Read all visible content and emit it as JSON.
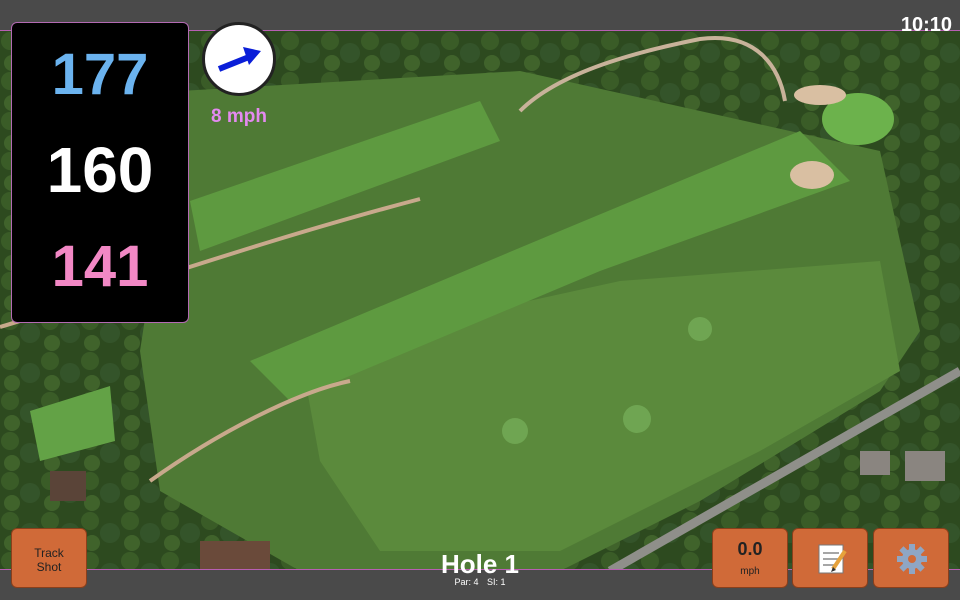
{
  "clock": "10:10",
  "yardage": {
    "back": "177",
    "center": "160",
    "front": "141"
  },
  "wind": {
    "speed_label": "8 mph",
    "icon": "wind-arrow-icon"
  },
  "buttons": {
    "track_shot_line1": "Track",
    "track_shot_line2": "Shot",
    "speed_value": "0.0",
    "speed_unit": "mph",
    "notes_icon": "notepad-icon",
    "settings_icon": "gear-icon"
  },
  "hole": {
    "title": "Hole 1",
    "par": "Par: 4",
    "si": "SI: 1"
  },
  "colors": {
    "back_yardage": "#6bb3ef",
    "center_yardage": "#ffffff",
    "front_yardage": "#f288c5",
    "button": "#d06a38",
    "wind_label": "#e48af0"
  }
}
